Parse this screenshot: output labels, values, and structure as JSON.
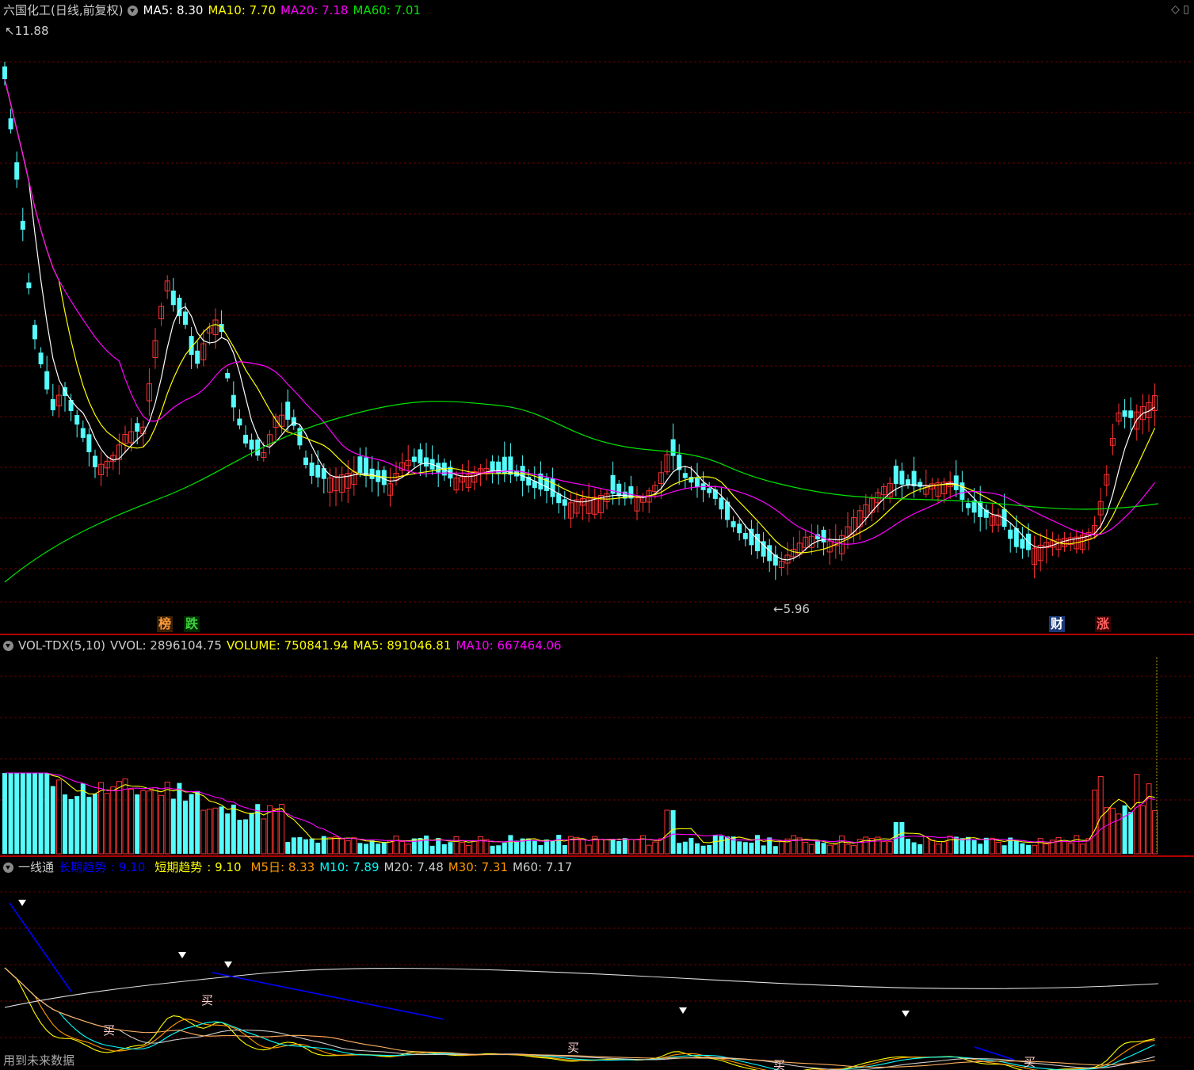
{
  "price_panel": {
    "title": "六国化工(日线,前复权)",
    "ma5": "MA5: 8.30",
    "ma10": "MA10: 7.70",
    "ma20": "MA20: 7.18",
    "ma60": "MA60: 7.01",
    "high_mark": "11.88",
    "low_mark": "5.96",
    "badges": [
      "榜",
      "跌",
      "财",
      "涨"
    ],
    "colors": {
      "up": "#ff3232",
      "down": "#54fcfc",
      "ma5": "#ffffff",
      "ma10": "#ffff00",
      "ma20": "#ff00ff",
      "ma60": "#00e600"
    }
  },
  "volume_panel": {
    "name": "VOL-TDX(5,10)",
    "vvol": "VVOL: 2896104.75",
    "volume": "VOLUME: 750841.94",
    "ma5": "MA5: 891046.81",
    "ma10": "MA10: 667464.06"
  },
  "indicator_panel": {
    "name": "一线通",
    "long_trend_label": "长期趋势",
    "long_trend_value": ": 9.10",
    "short_trend_label": "短期趋势",
    "short_trend_value": ": 9.10",
    "m5": "M5日: 8.33",
    "m10": "M10: 7.89",
    "m20": "M20: 7.48",
    "m30": "M30: 7.31",
    "m60": "M60: 7.17",
    "buy_marker": "买",
    "footer_note": "用到未来数据"
  },
  "icons": [
    "collapse-icon",
    "diamond-icon",
    "sell-arrow-icon"
  ]
}
